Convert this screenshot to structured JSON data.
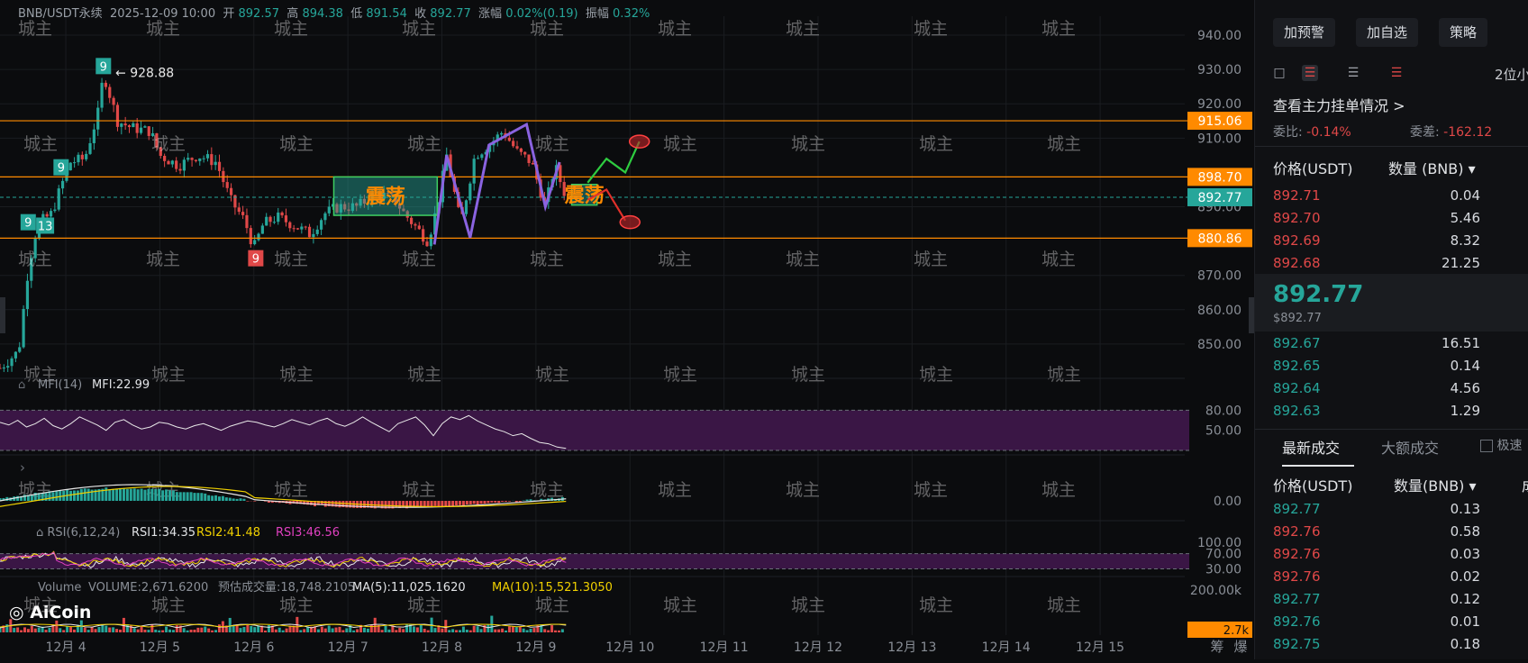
{
  "header": {
    "symbol": "BNB/USDT永续",
    "datetime": "2025-12-09 10:00",
    "open_label": "开",
    "open": "892.57",
    "high_label": "高",
    "high": "894.38",
    "low_label": "低",
    "low": "891.54",
    "close_label": "收",
    "close": "892.77",
    "change_label": "涨幅",
    "change": "0.02%(0.19)",
    "amp_label": "振幅",
    "amp": "0.32%"
  },
  "chart_data": {
    "type": "candlestick",
    "price_axis": {
      "ylim": [
        840,
        945
      ],
      "ticks": [
        "940.00",
        "930.00",
        "920.00",
        "910.00",
        "890.00",
        "870.00",
        "860.00",
        "850.00"
      ]
    },
    "x_ticks": [
      "12月 4",
      "12月 5",
      "12月 6",
      "12月 7",
      "12月 8",
      "12月 9",
      "12月 10",
      "12月 11",
      "12月 12",
      "12月 13",
      "12月 14",
      "12月 15"
    ],
    "x_ticks_days": [
      4,
      5,
      6,
      7,
      8,
      9,
      10,
      11,
      12,
      13,
      14,
      15
    ],
    "x_range_days": [
      3.3,
      15.9
    ],
    "price_path": [
      [
        3.3,
        843
      ],
      [
        3.5,
        848
      ],
      [
        3.6,
        872
      ],
      [
        3.7,
        885
      ],
      [
        3.85,
        888
      ],
      [
        3.95,
        896
      ],
      [
        4.05,
        903
      ],
      [
        4.2,
        904
      ],
      [
        4.35,
        918
      ],
      [
        4.4,
        928.88
      ],
      [
        4.55,
        915
      ],
      [
        4.7,
        913
      ],
      [
        4.9,
        912
      ],
      [
        5.0,
        905
      ],
      [
        5.2,
        902
      ],
      [
        5.4,
        905
      ],
      [
        5.6,
        903
      ],
      [
        5.75,
        892
      ],
      [
        5.9,
        886
      ],
      [
        6.0,
        878
      ],
      [
        6.1,
        885
      ],
      [
        6.25,
        887
      ],
      [
        6.4,
        885
      ],
      [
        6.6,
        882
      ],
      [
        6.75,
        888
      ],
      [
        6.9,
        890
      ],
      [
        7.1,
        890
      ],
      [
        7.3,
        894
      ],
      [
        7.5,
        892
      ],
      [
        7.6,
        888
      ],
      [
        7.85,
        880
      ],
      [
        7.95,
        890
      ],
      [
        8.05,
        905
      ],
      [
        8.2,
        885
      ],
      [
        8.35,
        905
      ],
      [
        8.5,
        908
      ],
      [
        8.65,
        912
      ],
      [
        8.8,
        906
      ],
      [
        8.95,
        903
      ],
      [
        9.1,
        890
      ],
      [
        9.2,
        902
      ],
      [
        9.32,
        892.77
      ]
    ],
    "horizontal_levels": [
      {
        "price": 915.06,
        "label": "915.06",
        "color": "#ff8a00"
      },
      {
        "price": 898.7,
        "label": "898.70",
        "color": "#ff8a00"
      },
      {
        "price": 880.86,
        "label": "880.86",
        "color": "#ff8a00"
      }
    ],
    "last_price": {
      "price": 892.77,
      "label": "892.77",
      "color": "#26a69a"
    },
    "td_labels": [
      {
        "day": 4.4,
        "price": 931,
        "text": "9",
        "color": "#26a69a"
      },
      {
        "day": 3.95,
        "price": 901.5,
        "text": "9",
        "color": "#26a69a"
      },
      {
        "day": 3.6,
        "price": 885.5,
        "text": "9",
        "color": "#26a69a"
      },
      {
        "day": 3.78,
        "price": 884.5,
        "text": "13",
        "color": "#26a69a"
      },
      {
        "day": 6.02,
        "price": 875,
        "text": "9",
        "color": "#e04848"
      }
    ],
    "high_annotation": {
      "day": 4.45,
      "price": 928.88,
      "text": "← 928.88"
    },
    "range_boxes": [
      {
        "day0": 6.85,
        "day1": 7.95,
        "p_top": 898.7,
        "p_bot": 887.5,
        "text": "震荡"
      },
      {
        "day0": 9.38,
        "day1": 9.65,
        "p_top": 896.5,
        "p_bot": 890.5,
        "text": "震荡"
      }
    ],
    "purple_path": [
      [
        7.92,
        879
      ],
      [
        8.05,
        905
      ],
      [
        8.3,
        881
      ],
      [
        8.5,
        908
      ],
      [
        8.9,
        914
      ],
      [
        9.1,
        890
      ],
      [
        9.25,
        903
      ]
    ],
    "bull_path": [
      [
        9.55,
        897
      ],
      [
        9.75,
        904
      ],
      [
        9.95,
        900
      ],
      [
        10.1,
        909
      ]
    ],
    "bear_path": [
      [
        9.55,
        892
      ],
      [
        9.75,
        895
      ],
      [
        9.95,
        886
      ]
    ],
    "target_ellipses": [
      [
        10.1,
        909
      ],
      [
        10.0,
        885.5
      ]
    ],
    "mfi": {
      "title": "MFI(14)",
      "value_label": "MFI:22.99",
      "ticks": [
        "80.00",
        "50.00"
      ],
      "values": [
        62,
        58,
        65,
        55,
        60,
        68,
        57,
        52,
        60,
        70,
        64,
        58,
        50,
        62,
        66,
        58,
        52,
        55,
        62,
        60,
        55,
        52,
        57,
        60,
        55,
        50,
        56,
        60,
        64,
        62,
        58,
        55,
        60,
        66,
        62,
        58,
        64,
        68,
        60,
        56,
        62,
        70,
        62,
        55,
        48,
        60,
        65,
        70,
        58,
        42,
        60,
        70,
        66,
        72,
        64,
        58,
        52,
        48,
        42,
        45,
        38,
        32,
        30,
        25,
        23
      ]
    },
    "macd": {
      "tick": "0.00"
    },
    "rsi": {
      "title": "RSI(6,12,24)",
      "rsi1": "RSI1:34.35",
      "rsi2": "RSI2:41.48",
      "rsi3": "RSI3:46.56",
      "ticks": [
        "100.00",
        "70.00",
        "30.00"
      ]
    },
    "volume": {
      "title": "Volume",
      "vol": "VOLUME:2,671.6200",
      "est": "预估成交量:18,748.2105",
      "ma5": "MA(5):11,025.1620",
      "ma10": "MA(10):15,521.3050",
      "tick": "200.00k",
      "last": "2.7k"
    },
    "footer_right": [
      "筹",
      "爆"
    ]
  },
  "watermark": "城主",
  "logo": "AiCoin",
  "colors": {
    "bull": "#26a69a",
    "bear": "#e04848",
    "level": "#ff8a00",
    "purple": "#8a63e0",
    "box": "#3ecf62",
    "mfi_band": "#3a1645"
  },
  "sidebar": {
    "buttons": [
      "加预警",
      "加自选",
      "策略"
    ],
    "decimals": "2位小",
    "depth_link": "查看主力挂单情况 >",
    "ratio_label": "委比:",
    "ratio": "-0.14%",
    "diff_label": "委差:",
    "diff": "-162.12",
    "col_price": "价格(USDT)",
    "col_qty": "数量 (BNB) ▾",
    "asks": [
      {
        "p": "892.71",
        "q": "0.04"
      },
      {
        "p": "892.70",
        "q": "5.46"
      },
      {
        "p": "892.69",
        "q": "8.32"
      },
      {
        "p": "892.68",
        "q": "21.25"
      }
    ],
    "mid_price": "892.77",
    "mid_sub": "$892.77",
    "bids": [
      {
        "p": "892.67",
        "q": "16.51"
      },
      {
        "p": "892.65",
        "q": "0.14"
      },
      {
        "p": "892.64",
        "q": "4.56"
      },
      {
        "p": "892.63",
        "q": "1.29"
      }
    ],
    "tab_latest": "最新成交",
    "tab_large": "大额成交",
    "fast_label": "极速",
    "trade_col_price": "价格(USDT)",
    "trade_col_qty": "数量(BNB) ▾",
    "trade_col_extra": "成",
    "trades": [
      {
        "p": "892.77",
        "q": "0.13",
        "s": "buy"
      },
      {
        "p": "892.76",
        "q": "0.58",
        "s": "sell"
      },
      {
        "p": "892.76",
        "q": "0.03",
        "s": "sell"
      },
      {
        "p": "892.76",
        "q": "0.02",
        "s": "sell"
      },
      {
        "p": "892.77",
        "q": "0.12",
        "s": "buy"
      },
      {
        "p": "892.76",
        "q": "0.01",
        "s": "buy"
      },
      {
        "p": "892.75",
        "q": "0.18",
        "s": "buy"
      }
    ]
  }
}
